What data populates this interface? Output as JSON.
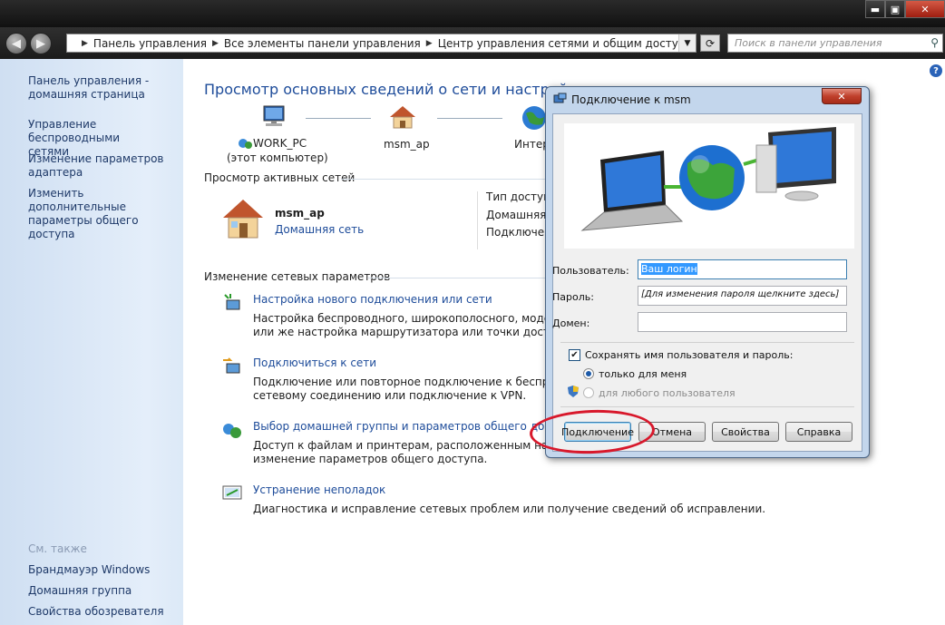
{
  "window": {
    "min": "▬",
    "max": "▣",
    "close": "✕"
  },
  "nav": {
    "back": "◀",
    "forward": "▶",
    "breadcrumb": [
      "Панель управления",
      "Все элементы панели управления",
      "Центр управления сетями и общим доступом"
    ],
    "search_placeholder": "Поиск в панели управления"
  },
  "sidebar": {
    "home": [
      "Панель управления -",
      "домашняя страница"
    ],
    "links": [
      [
        "Управление беспроводными",
        "сетями"
      ],
      [
        "Изменение параметров",
        "адаптера"
      ],
      [
        "Изменить дополнительные",
        "параметры общего доступа"
      ]
    ],
    "see_also": "См. также",
    "see_also_links": [
      "Брандмауэр Windows",
      "Домашняя группа",
      "Свойства обозревателя"
    ]
  },
  "main": {
    "title": "Просмотр основных сведений о сети и настройка по",
    "map": {
      "pc_name": "WORK_PC",
      "pc_sub": "(этот компьютер)",
      "router": "msm_ap",
      "internet": "Интер"
    },
    "active_header": "Просмотр активных сетей",
    "active_net": {
      "name": "msm_ap",
      "type": "Домашняя сеть"
    },
    "active_right": [
      "Тип доступа",
      "Домашняя г",
      "Подключен"
    ],
    "change_header": "Изменение сетевых параметров",
    "tasks": [
      {
        "title": "Настройка нового подключения или сети",
        "desc": [
          "Настройка беспроводного, широкополосного, модемного",
          "или же настройка маршрутизатора или точки доступа."
        ]
      },
      {
        "title": "Подключиться к сети",
        "desc": [
          "Подключение или повторное подключение к беспровод",
          "сетевому соединению или подключение к VPN."
        ]
      },
      {
        "title": "Выбор домашней группы и параметров общего доступа",
        "desc": [
          "Доступ к файлам и принтерам, расположенным на други",
          "изменение параметров общего доступа."
        ]
      },
      {
        "title": "Устранение неполадок",
        "desc": [
          "Диагностика и исправление сетевых проблем или получение сведений об исправлении."
        ]
      }
    ]
  },
  "dialog": {
    "title": "Подключение к msm",
    "close": "✕",
    "user_label": "Пользователь:",
    "user_value": "Ваш логин",
    "password_label": "Пароль:",
    "password_value": "[Для изменения пароля щелкните здесь]",
    "domain_label": "Домен:",
    "domain_value": "",
    "save_label": "Сохранять имя пользователя и пароль:",
    "save_checked": true,
    "radio_me": "только для меня",
    "radio_any": "для любого пользователя",
    "buttons": {
      "connect": "Подключение",
      "cancel": "Отмена",
      "props": "Свойства",
      "help": "Справка"
    }
  },
  "help_icon": "?"
}
